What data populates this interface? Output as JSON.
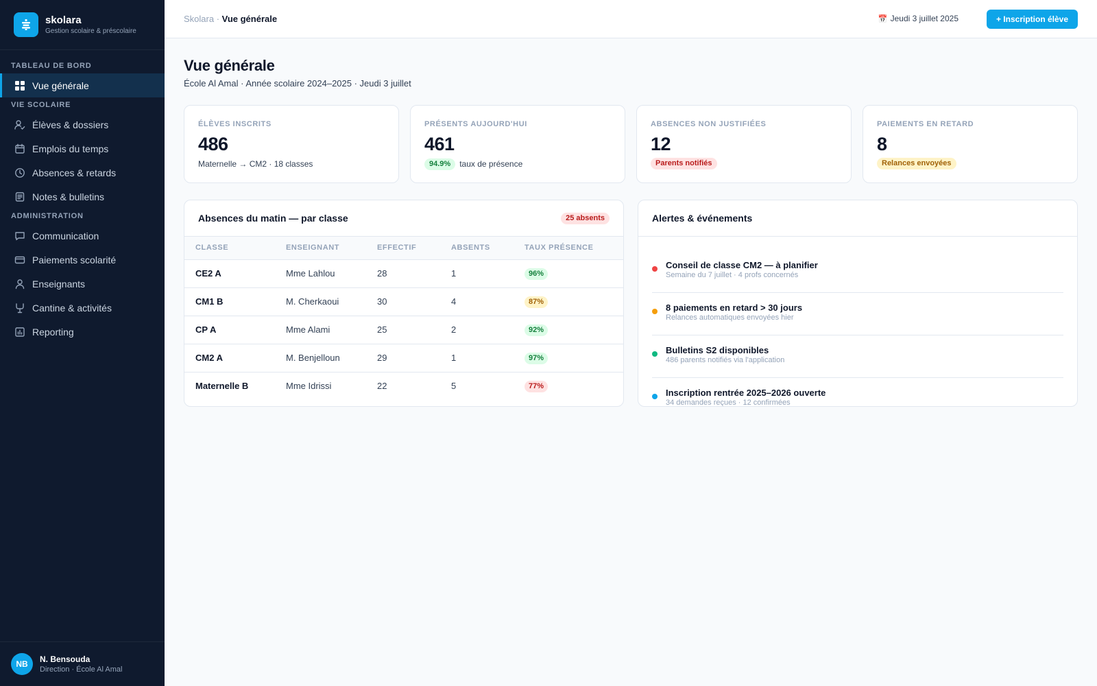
{
  "brand": {
    "name": "skolara",
    "tagline": "Gestion scolaire & préscolaire",
    "icon": "school-logo-icon",
    "color": "#0ea5e9"
  },
  "sidebar": {
    "sections": [
      {
        "label": "TABLEAU DE BORD",
        "items": [
          {
            "label": "Vue générale",
            "icon": "grid-icon",
            "active": true
          }
        ]
      },
      {
        "label": "VIE SCOLAIRE",
        "items": [
          {
            "label": "Élèves & dossiers",
            "icon": "user-check-icon"
          },
          {
            "label": "Emplois du temps",
            "icon": "calendar-icon"
          },
          {
            "label": "Absences & retards",
            "icon": "clock-icon"
          },
          {
            "label": "Notes & bulletins",
            "icon": "document-icon"
          }
        ]
      },
      {
        "label": "ADMINISTRATION",
        "items": [
          {
            "label": "Communication",
            "icon": "message-icon"
          },
          {
            "label": "Paiements scolarité",
            "icon": "credit-card-icon"
          },
          {
            "label": "Enseignants",
            "icon": "person-icon"
          },
          {
            "label": "Cantine & activités",
            "icon": "utensils-icon"
          },
          {
            "label": "Reporting",
            "icon": "chart-icon"
          }
        ]
      }
    ],
    "user": {
      "initials": "NB",
      "name": "N. Bensouda",
      "role": "Direction · École Al Amal"
    }
  },
  "topbar": {
    "breadcrumb": {
      "root": "Skolara",
      "separator": " · ",
      "current": "Vue générale"
    },
    "date_icon": "calendar-emoji-icon",
    "date": "Jeudi 3 juillet 2025",
    "primary_button": "+ Inscription élève"
  },
  "page": {
    "title": "Vue générale",
    "subtitle": "École Al Amal · Année scolaire 2024–2025 · Jeudi 3 juillet"
  },
  "kpis": [
    {
      "label": "Élèves inscrits",
      "value": "486",
      "note": "Maternelle → CM2 · 18 classes"
    },
    {
      "label": "Présents aujourd'hui",
      "value": "461",
      "pill": "94.9%",
      "note": "taux de présence",
      "pill_color": "#15803d"
    },
    {
      "label": "Absences non justifiées",
      "value": "12",
      "pill": "Parents notifiés",
      "pill_color": "#b91c1c"
    },
    {
      "label": "Paiements en retard",
      "value": "8",
      "pill": "Relances envoyées",
      "pill_color": "#a16207"
    }
  ],
  "absences": {
    "title": "Absences du matin — par classe",
    "badge": "25 absents",
    "columns": [
      "Classe",
      "Enseignant",
      "Effectif",
      "Absents",
      "Taux présence"
    ],
    "rows": [
      {
        "classe": "CE2 A",
        "enseignant": "Mme Lahlou",
        "effectif": "28",
        "absents": "1",
        "taux": "96%",
        "level": "good"
      },
      {
        "classe": "CM1 B",
        "enseignant": "M. Cherkaoui",
        "effectif": "30",
        "absents": "4",
        "taux": "87%",
        "level": "warn"
      },
      {
        "classe": "CP A",
        "enseignant": "Mme Alami",
        "effectif": "25",
        "absents": "2",
        "taux": "92%",
        "level": "good"
      },
      {
        "classe": "CM2 A",
        "enseignant": "M. Benjelloun",
        "effectif": "29",
        "absents": "1",
        "taux": "97%",
        "level": "good"
      },
      {
        "classe": "Maternelle B",
        "enseignant": "Mme Idrissi",
        "effectif": "22",
        "absents": "5",
        "taux": "77%",
        "level": "bad"
      }
    ],
    "level_colors": {
      "good": {
        "bg": "#dcfce7",
        "fg": "#15803d"
      },
      "warn": {
        "bg": "#fef3c7",
        "fg": "#a16207"
      },
      "bad": {
        "bg": "#fee2e2",
        "fg": "#b91c1c"
      }
    }
  },
  "alerts": {
    "title": "Alertes & événements",
    "items": [
      {
        "title": "Conseil de classe CM2 — à planifier",
        "sub": "Semaine du 7 juillet · 4 profs concernés",
        "color": "#ef4444"
      },
      {
        "title": "8 paiements en retard > 30 jours",
        "sub": "Relances automatiques envoyées hier",
        "color": "#f59e0b"
      },
      {
        "title": "Bulletins S2 disponibles",
        "sub": "486 parents notifiés via l'application",
        "color": "#10b981"
      },
      {
        "title": "Inscription rentrée 2025–2026 ouverte",
        "sub": "34 demandes reçues · 12 confirmées",
        "color": "#0ea5e9"
      }
    ]
  }
}
